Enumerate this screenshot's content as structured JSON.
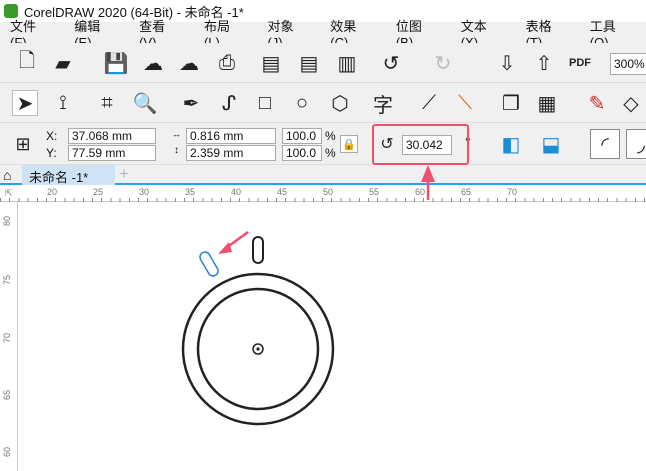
{
  "title": "CorelDRAW 2020 (64-Bit) - 未命名 -1*",
  "menu": [
    "文件(F)",
    "编辑(E)",
    "查看(V)",
    "布局(L)",
    "对象(J)",
    "效果(C)",
    "位图(B)",
    "文本(X)",
    "表格(T)",
    "工具(O)"
  ],
  "toolbar": {
    "zoom": "300%",
    "pdf": "PDF"
  },
  "props": {
    "x_label": "X:",
    "y_label": "Y:",
    "x": "37.068 mm",
    "y": "77.59 mm",
    "w": "0.816 mm",
    "h": "2.359 mm",
    "sx": "100.0",
    "sy": "100.0",
    "pct": "%",
    "rotation": "30.042",
    "deg": "°"
  },
  "doc_tab": "未命名 -1*",
  "hruler": [
    "20",
    "25",
    "30",
    "35",
    "40",
    "45",
    "50",
    "55",
    "60",
    "65",
    "70"
  ],
  "vruler": [
    "80",
    "75",
    "70",
    "65",
    "60"
  ],
  "colors": {
    "accent": "#2aa0e8",
    "highlight": "#f0506e",
    "selected": "#2a7fd4"
  }
}
